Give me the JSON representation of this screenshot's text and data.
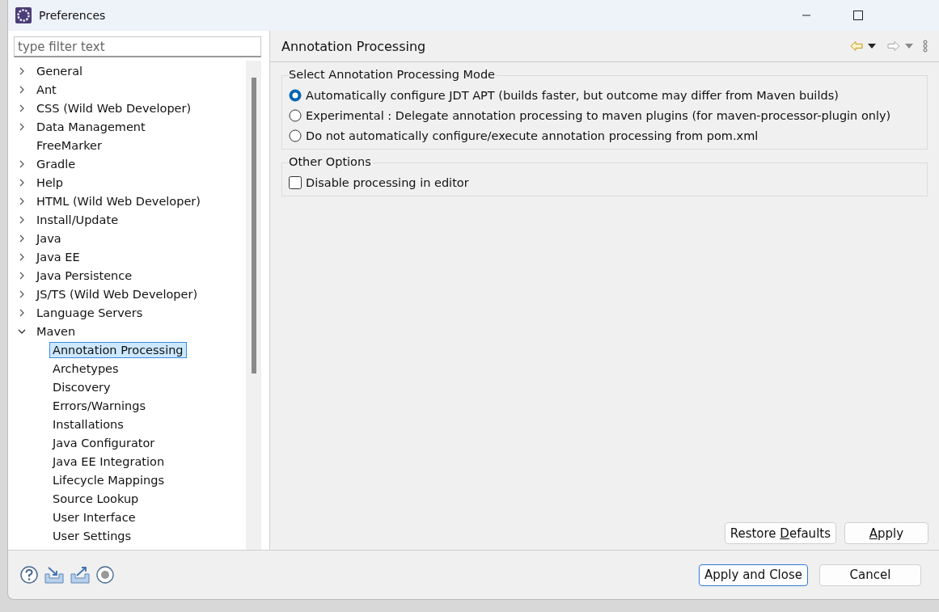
{
  "window": {
    "title": "Preferences"
  },
  "filter": {
    "placeholder": "type filter text"
  },
  "tree": [
    {
      "kind": "folder",
      "label": "General",
      "expanded": false,
      "selected": false
    },
    {
      "kind": "folder",
      "label": "Ant",
      "expanded": false,
      "selected": false
    },
    {
      "kind": "folder",
      "label": "CSS (Wild Web Developer)",
      "expanded": false,
      "selected": false
    },
    {
      "kind": "folder",
      "label": "Data Management",
      "expanded": false,
      "selected": false
    },
    {
      "kind": "leaf",
      "label": "FreeMarker",
      "selected": false
    },
    {
      "kind": "folder",
      "label": "Gradle",
      "expanded": false,
      "selected": false
    },
    {
      "kind": "folder",
      "label": "Help",
      "expanded": false,
      "selected": false
    },
    {
      "kind": "folder",
      "label": "HTML (Wild Web Developer)",
      "expanded": false,
      "selected": false
    },
    {
      "kind": "folder",
      "label": "Install/Update",
      "expanded": false,
      "selected": false
    },
    {
      "kind": "folder",
      "label": "Java",
      "expanded": false,
      "selected": false
    },
    {
      "kind": "folder",
      "label": "Java EE",
      "expanded": false,
      "selected": false
    },
    {
      "kind": "folder",
      "label": "Java Persistence",
      "expanded": false,
      "selected": false
    },
    {
      "kind": "folder",
      "label": "JS/TS (Wild Web Developer)",
      "expanded": false,
      "selected": false
    },
    {
      "kind": "folder",
      "label": "Language Servers",
      "expanded": false,
      "selected": false
    },
    {
      "kind": "folder",
      "label": "Maven",
      "expanded": true,
      "selected": false,
      "children": [
        {
          "kind": "leaf",
          "label": "Annotation Processing",
          "selected": true
        },
        {
          "kind": "leaf",
          "label": "Archetypes",
          "selected": false
        },
        {
          "kind": "leaf",
          "label": "Discovery",
          "selected": false
        },
        {
          "kind": "leaf",
          "label": "Errors/Warnings",
          "selected": false
        },
        {
          "kind": "leaf",
          "label": "Installations",
          "selected": false
        },
        {
          "kind": "leaf",
          "label": "Java Configurator",
          "selected": false
        },
        {
          "kind": "leaf",
          "label": "Java EE Integration",
          "selected": false
        },
        {
          "kind": "leaf",
          "label": "Lifecycle Mappings",
          "selected": false
        },
        {
          "kind": "leaf",
          "label": "Source Lookup",
          "selected": false
        },
        {
          "kind": "leaf",
          "label": "User Interface",
          "selected": false
        },
        {
          "kind": "leaf",
          "label": "User Settings",
          "selected": false
        }
      ]
    }
  ],
  "page": {
    "title": "Annotation Processing",
    "groups": [
      {
        "title": "Select Annotation Processing Mode",
        "options": [
          {
            "kind": "radio",
            "label": "Automatically configure JDT APT (builds faster, but outcome may differ from Maven builds)",
            "selected": true
          },
          {
            "kind": "radio",
            "label": "Experimental : Delegate annotation processing to maven plugins (for maven-processor-plugin only)",
            "selected": false
          },
          {
            "kind": "radio",
            "label": "Do not automatically configure/execute annotation processing from pom.xml",
            "selected": false
          }
        ]
      },
      {
        "title": "Other Options",
        "options": [
          {
            "kind": "checkbox",
            "label": "Disable processing in editor",
            "checked": false
          }
        ]
      }
    ],
    "buttons": [
      {
        "label": "Restore **D**efaults",
        "focused": false
      },
      {
        "label": "**A**pply",
        "focused": false
      }
    ]
  },
  "dialog_buttons": [
    {
      "label": "Apply and Close",
      "focused": true
    },
    {
      "label": "Cancel",
      "focused": false
    }
  ]
}
